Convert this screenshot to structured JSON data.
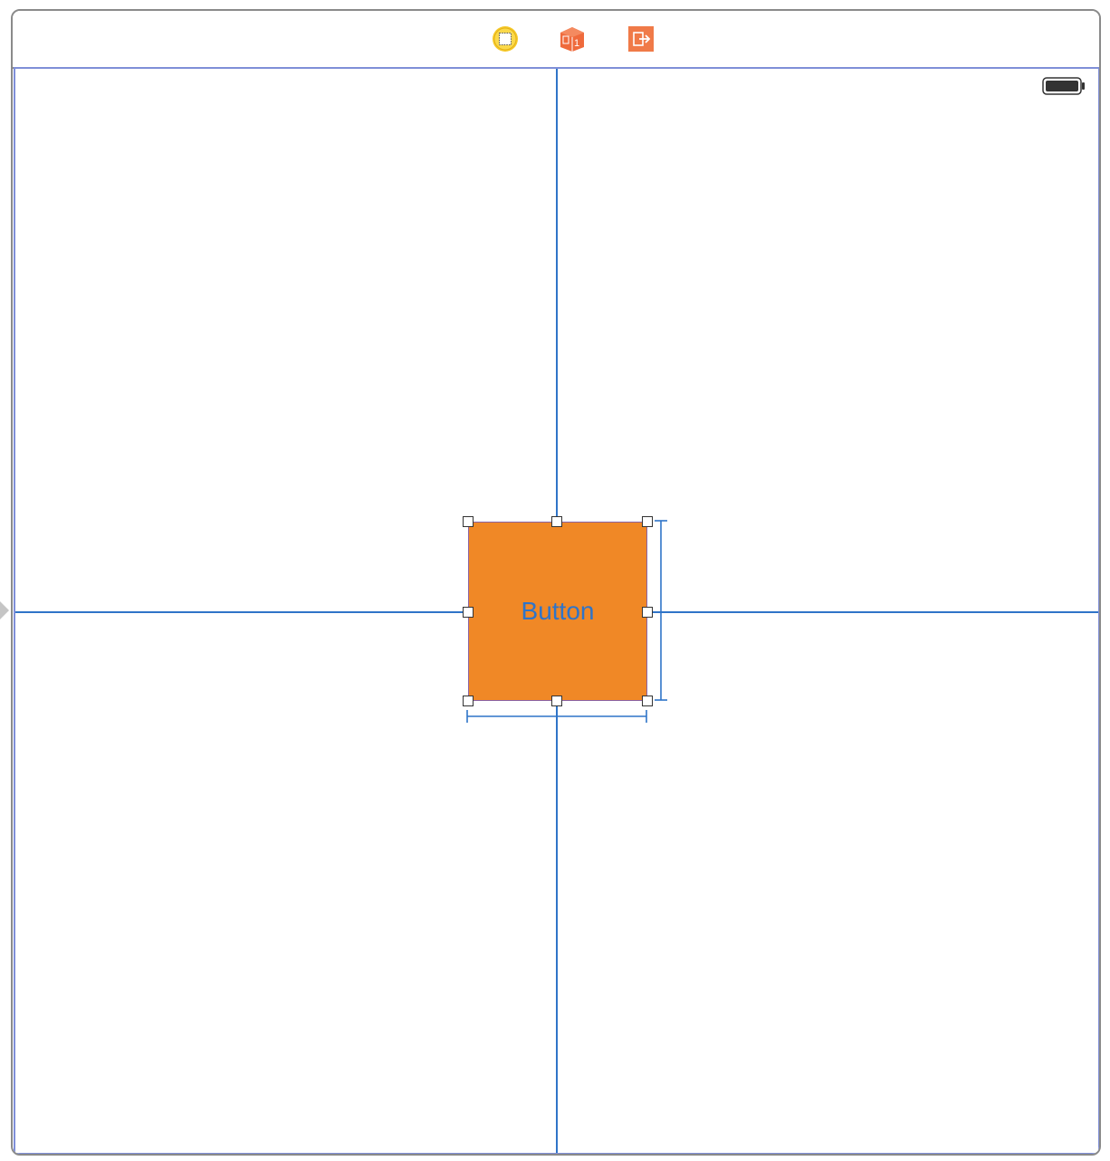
{
  "scene_dock": {
    "icons": [
      {
        "name": "view-controller-icon",
        "color": "#f6c928"
      },
      {
        "name": "first-responder-icon",
        "color": "#ef6a3c"
      },
      {
        "name": "exit-icon",
        "color": "#f07a48"
      }
    ]
  },
  "status_bar": {
    "battery_icon": "battery-icon"
  },
  "canvas": {
    "guide_color": "#2f74c8",
    "border_color": "#7f8fd8"
  },
  "button": {
    "label": "Button",
    "background": "#f08826",
    "text_color": "#2f74c8"
  }
}
